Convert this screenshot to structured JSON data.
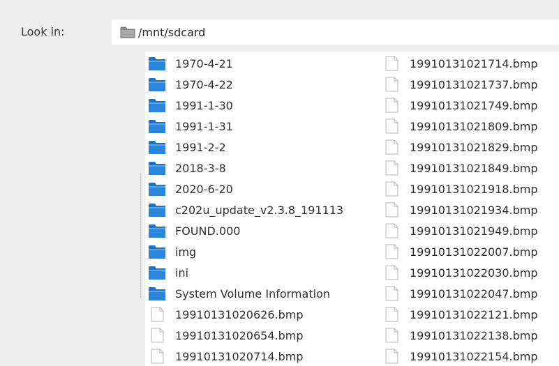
{
  "look_in": {
    "label": "Look in:",
    "path": "/mnt/sdcard"
  },
  "colors": {
    "folder_blue": "#2a86d8",
    "path_folder_gray": "#8f8f8f"
  },
  "files": {
    "column_1": [
      {
        "name": "1970-4-21",
        "type": "folder",
        "icon": "folder-icon"
      },
      {
        "name": "1970-4-22",
        "type": "folder",
        "icon": "folder-icon"
      },
      {
        "name": "1991-1-30",
        "type": "folder",
        "icon": "folder-icon"
      },
      {
        "name": "1991-1-31",
        "type": "folder",
        "icon": "folder-icon"
      },
      {
        "name": "1991-2-2",
        "type": "folder",
        "icon": "folder-icon"
      },
      {
        "name": "2018-3-8",
        "type": "folder",
        "icon": "folder-icon"
      },
      {
        "name": "2020-6-20",
        "type": "folder",
        "icon": "folder-icon"
      },
      {
        "name": "c202u_update_v2.3.8_191113",
        "type": "folder",
        "icon": "folder-icon"
      },
      {
        "name": "FOUND.000",
        "type": "folder",
        "icon": "folder-icon"
      },
      {
        "name": "img",
        "type": "folder",
        "icon": "folder-icon"
      },
      {
        "name": "ini",
        "type": "folder",
        "icon": "folder-icon"
      },
      {
        "name": "System Volume Information",
        "type": "folder",
        "icon": "folder-icon"
      },
      {
        "name": "19910131020626.bmp",
        "type": "file",
        "icon": "file-icon"
      },
      {
        "name": "19910131020654.bmp",
        "type": "file",
        "icon": "file-icon"
      },
      {
        "name": "19910131020714.bmp",
        "type": "file",
        "icon": "file-icon"
      }
    ],
    "column_2": [
      {
        "name": "19910131021714.bmp",
        "type": "file",
        "icon": "file-icon"
      },
      {
        "name": "19910131021737.bmp",
        "type": "file",
        "icon": "file-icon"
      },
      {
        "name": "19910131021749.bmp",
        "type": "file",
        "icon": "file-icon"
      },
      {
        "name": "19910131021809.bmp",
        "type": "file",
        "icon": "file-icon"
      },
      {
        "name": "19910131021829.bmp",
        "type": "file",
        "icon": "file-icon"
      },
      {
        "name": "19910131021849.bmp",
        "type": "file",
        "icon": "file-icon"
      },
      {
        "name": "19910131021918.bmp",
        "type": "file",
        "icon": "file-icon"
      },
      {
        "name": "19910131021934.bmp",
        "type": "file",
        "icon": "file-icon"
      },
      {
        "name": "19910131021949.bmp",
        "type": "file",
        "icon": "file-icon"
      },
      {
        "name": "19910131022007.bmp",
        "type": "file",
        "icon": "file-icon"
      },
      {
        "name": "19910131022030.bmp",
        "type": "file",
        "icon": "file-icon"
      },
      {
        "name": "19910131022047.bmp",
        "type": "file",
        "icon": "file-icon"
      },
      {
        "name": "19910131022121.bmp",
        "type": "file",
        "icon": "file-icon"
      },
      {
        "name": "19910131022138.bmp",
        "type": "file",
        "icon": "file-icon"
      },
      {
        "name": "19910131022154.bmp",
        "type": "file",
        "icon": "file-icon"
      }
    ]
  }
}
